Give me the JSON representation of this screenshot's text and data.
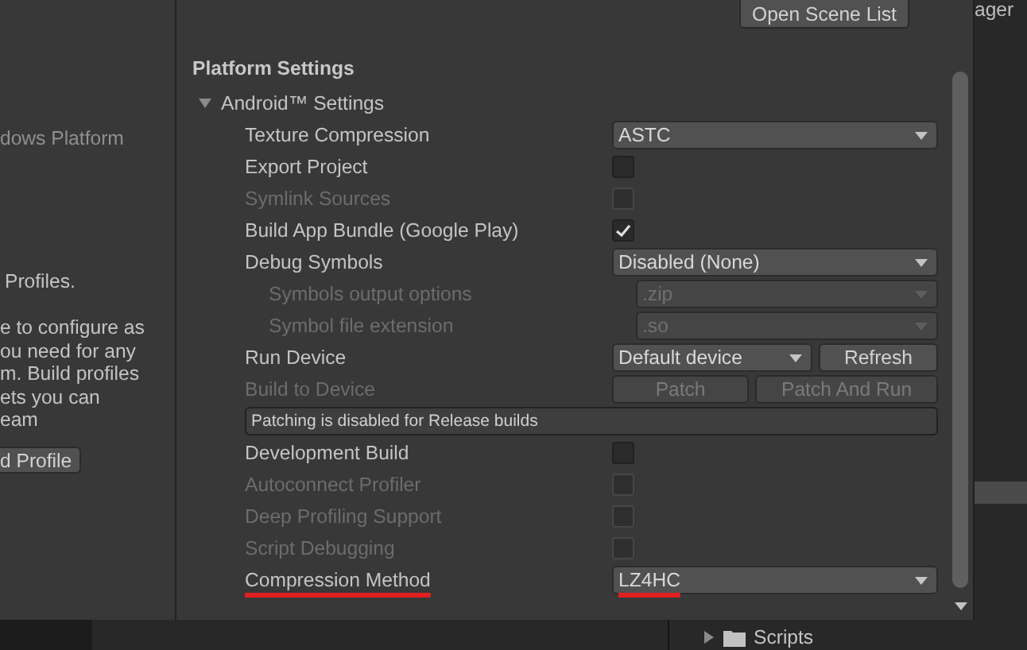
{
  "left_panel": {
    "platform_item": "dows Platform",
    "heading": "Profiles.",
    "description_lines": [
      "e to configure as",
      "ou need for any",
      "m. Build profiles",
      "ets you can",
      "eam"
    ],
    "button": "d Profile"
  },
  "toolbar": {
    "button": "Open Scene List"
  },
  "section_title": "Platform Settings",
  "foldout": {
    "label": "Android™ Settings",
    "expanded": true
  },
  "rows": [
    {
      "kind": "dropdown",
      "label": "Texture Compression",
      "value": "ASTC",
      "disabled": false,
      "underlined": false
    },
    {
      "kind": "checkbox",
      "label": "Export Project",
      "checked": false,
      "disabled": false
    },
    {
      "kind": "checkbox",
      "label": "Symlink Sources",
      "checked": false,
      "disabled": true
    },
    {
      "kind": "checkbox",
      "label": "Build App Bundle (Google Play)",
      "checked": true,
      "disabled": false
    },
    {
      "kind": "dropdown",
      "label": "Debug Symbols",
      "value": "Disabled (None)",
      "disabled": false,
      "underlined": false,
      "children": [
        {
          "kind": "dropdown",
          "label": "Symbols output options",
          "value": ".zip",
          "disabled": true,
          "underlined": false
        },
        {
          "kind": "dropdown",
          "label": "Symbol file extension",
          "value": ".so",
          "disabled": true,
          "underlined": false
        }
      ]
    },
    {
      "kind": "device",
      "label": "Run Device",
      "value": "Default device",
      "button": "Refresh",
      "disabled": false
    },
    {
      "kind": "buttons",
      "label": "Build to Device",
      "buttons": [
        "Patch",
        "Patch And Run"
      ],
      "disabled": true
    },
    {
      "kind": "notice",
      "text": "Patching is disabled for Release builds"
    },
    {
      "kind": "checkbox",
      "label": "Development Build",
      "checked": false,
      "disabled": false
    },
    {
      "kind": "checkbox",
      "label": "Autoconnect Profiler",
      "checked": false,
      "disabled": true
    },
    {
      "kind": "checkbox",
      "label": "Deep Profiling Support",
      "checked": false,
      "disabled": true
    },
    {
      "kind": "checkbox",
      "label": "Script Debugging",
      "checked": false,
      "disabled": true
    },
    {
      "kind": "dropdown",
      "label": "Compression Method",
      "value": "LZ4HC",
      "disabled": false,
      "underlined": true
    }
  ],
  "right_panel": {
    "title": "ager"
  },
  "project_tree": [
    {
      "label": "Scripts",
      "expanded": false
    }
  ]
}
